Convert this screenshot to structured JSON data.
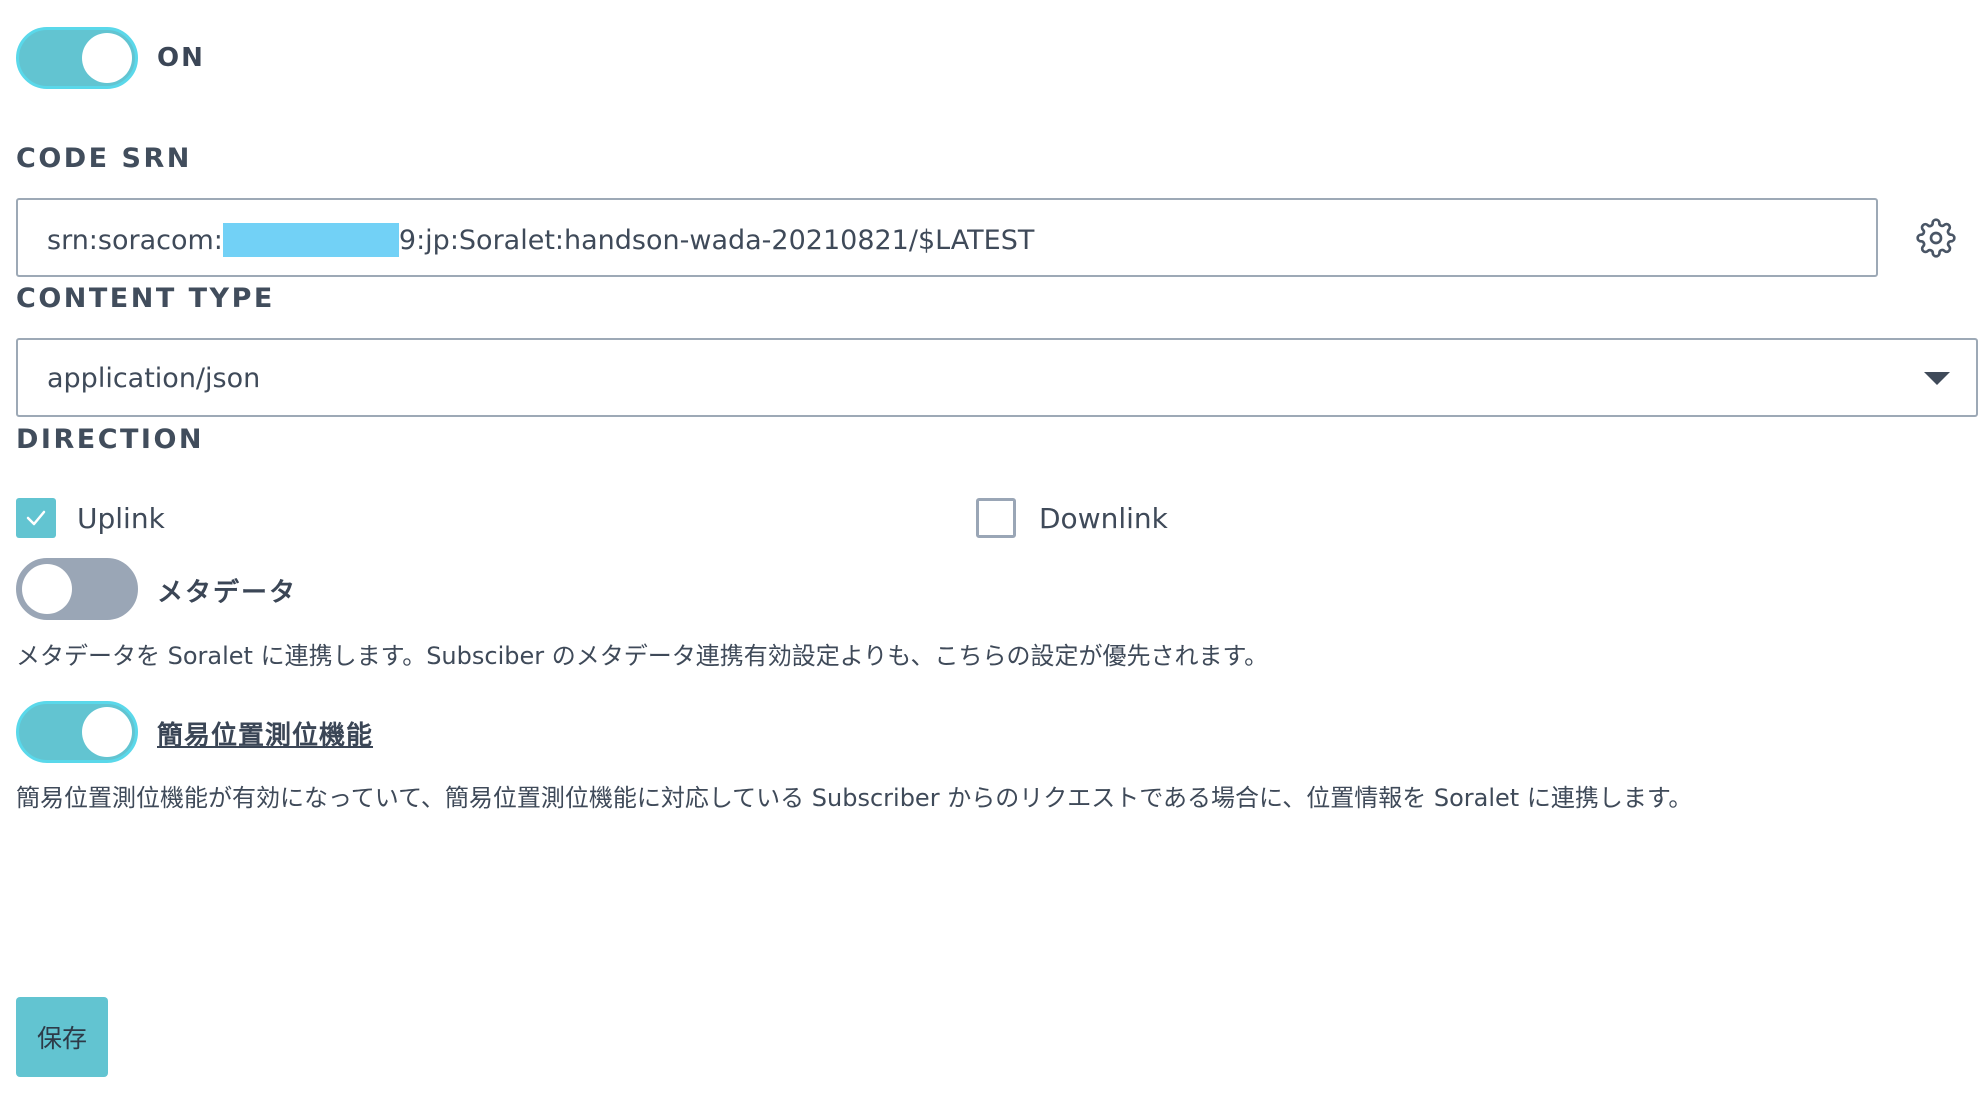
{
  "main_toggle": {
    "state": "on",
    "label": "ON"
  },
  "code_srn": {
    "label": "CODE SRN",
    "value_prefix": "srn:soracom:",
    "value_suffix": "9:jp:Soralet:handson-wada-20210821/$LATEST",
    "settings_icon": "gear-icon"
  },
  "content_type": {
    "label": "CONTENT TYPE",
    "selected": "application/json",
    "dropdown_icon": "caret-down-icon"
  },
  "direction": {
    "label": "DIRECTION",
    "options": [
      {
        "label": "Uplink",
        "checked": true
      },
      {
        "label": "Downlink",
        "checked": false
      }
    ]
  },
  "metadata": {
    "label": "メタデータ",
    "state": "off",
    "description": "メタデータを Soralet に連携します。Subsciber のメタデータ連携有効設定よりも、こちらの設定が優先されます。"
  },
  "simple_location": {
    "label": "簡易位置測位機能",
    "state": "on",
    "description": "簡易位置測位機能が有効になっていて、簡易位置測位機能に対応している Subscriber からのリクエストである場合に、位置情報を Soralet に連携します。"
  },
  "save_button": {
    "label": "保存"
  },
  "colors": {
    "accent": "#62c4d1",
    "toggle_off": "#9aa6b6",
    "text": "#3f4a59",
    "redaction": "#72d1f6"
  }
}
